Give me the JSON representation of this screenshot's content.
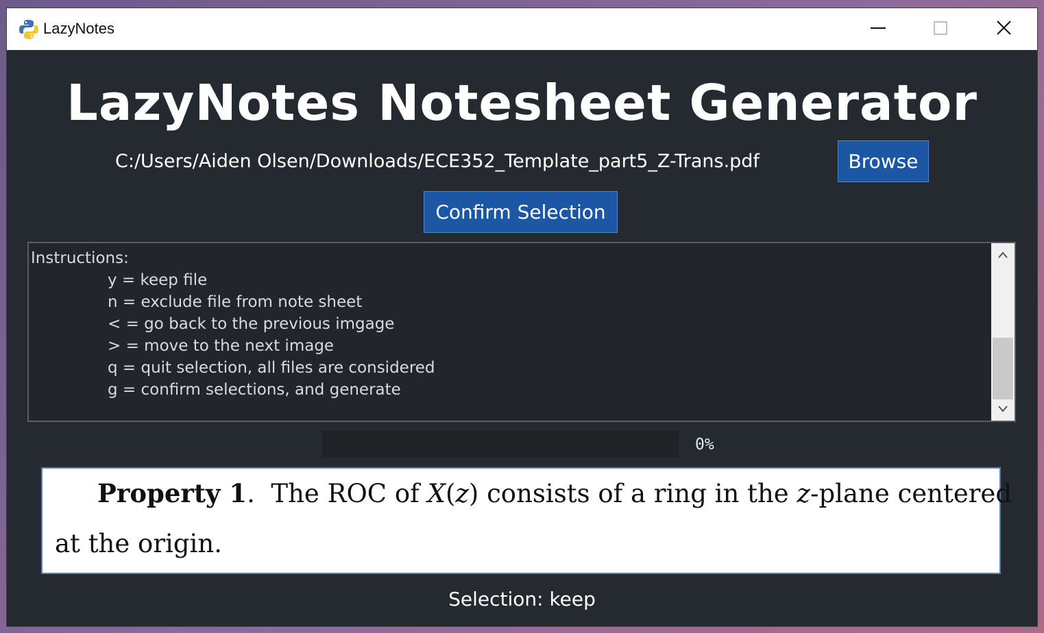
{
  "window": {
    "title": "LazyNotes",
    "controls": {
      "minimize": "minimize-icon",
      "maximize": "maximize-icon",
      "close": "close-icon"
    }
  },
  "header": {
    "title": "LazyNotes Notesheet Generator"
  },
  "file": {
    "path": "C:/Users/Aiden Olsen/Downloads/ECE352_Template_part5_Z-Trans.pdf",
    "browse_label": "Browse",
    "confirm_label": "Confirm Selection"
  },
  "instructions": {
    "heading": "Instructions:",
    "items": [
      "y = keep file",
      "n = exclude file from note sheet",
      "< = go back to the previous imgage",
      "> = move to the next image",
      "q = quit selection, all files are considered",
      "g = confirm selections, and generate"
    ]
  },
  "progress": {
    "value": 0,
    "label": "0%"
  },
  "preview": {
    "line1_bold": "Property 1",
    "line1_sep": ".",
    "line1_a": "The ROC of ",
    "line1_var": "X",
    "line1_b": "(",
    "line1_z1": "z",
    "line1_c": ") consists of a ring in the ",
    "line1_z2": "z",
    "line1_d": "-plane centered",
    "line2": "at the origin."
  },
  "status": {
    "selection": "Selection: keep"
  },
  "colors": {
    "background": "#252a31",
    "accent": "#1c57a5",
    "text": "#ffffff"
  }
}
